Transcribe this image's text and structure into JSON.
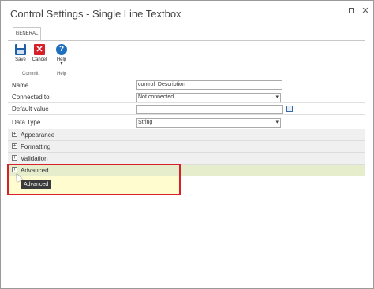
{
  "window": {
    "title": "Control Settings - Single Line Textbox",
    "maximize_icon": "maximize-icon",
    "close_icon": "close-icon"
  },
  "ribbon": {
    "tab": "GENERAL",
    "groups": [
      {
        "label": "Commit",
        "buttons": [
          {
            "label": "Save",
            "icon": "save-icon"
          },
          {
            "label": "Cancel",
            "icon": "cancel-icon"
          }
        ]
      },
      {
        "label": "Help",
        "buttons": [
          {
            "label": "Help",
            "icon": "help-icon",
            "chevron": "▾"
          }
        ]
      }
    ]
  },
  "form": {
    "name": {
      "label": "Name",
      "value": "control_Description"
    },
    "connected_to": {
      "label": "Connected to",
      "value": "Not connected"
    },
    "default_value": {
      "label": "Default value",
      "value": ""
    },
    "data_type": {
      "label": "Data Type",
      "value": "String"
    }
  },
  "sections": [
    {
      "label": "Appearance"
    },
    {
      "label": "Formatting"
    },
    {
      "label": "Validation"
    },
    {
      "label": "Advanced"
    }
  ],
  "tooltip": "Advanced",
  "colors": {
    "highlight": "#d6202a",
    "active_section": "#e6edcd",
    "advanced_body": "#fffdd0"
  }
}
